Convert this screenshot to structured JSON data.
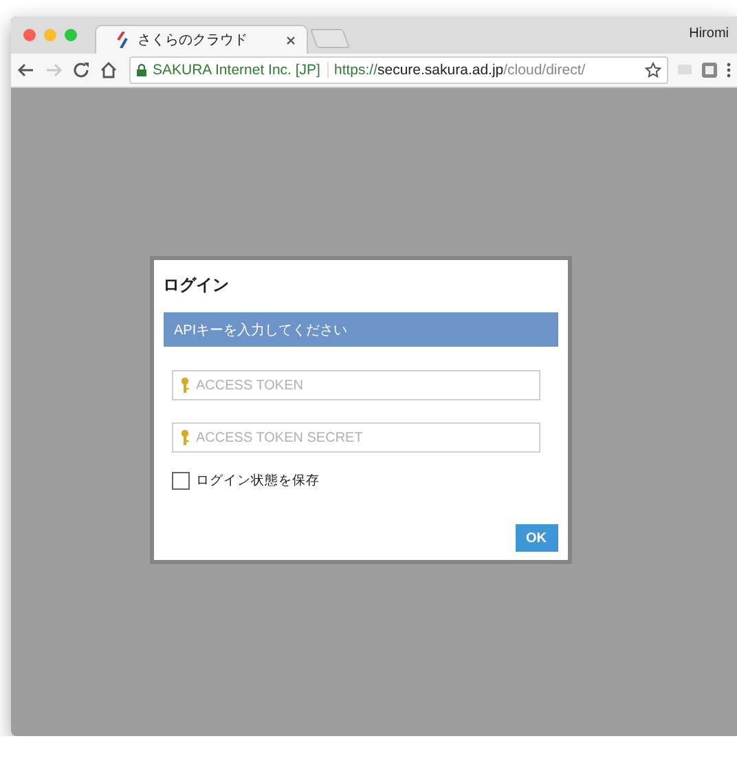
{
  "browser": {
    "tabs": [
      {
        "title": "さくらのクラウド",
        "selected": true
      }
    ],
    "profile": "Hiromi",
    "address_bar": {
      "site_identity": "SAKURA Internet Inc. [JP]",
      "url_scheme": "https://",
      "url_host": "secure.sakura.ad.jp",
      "url_path": "/cloud/direct/"
    }
  },
  "dialog": {
    "title": "ログイン",
    "banner": "APIキーを入力してください",
    "fields": [
      {
        "placeholder": "ACCESS TOKEN"
      },
      {
        "placeholder": "ACCESS TOKEN SECRET"
      }
    ],
    "remember": {
      "label": "ログイン状態を保存",
      "checked": false
    },
    "ok_button": "OK"
  }
}
